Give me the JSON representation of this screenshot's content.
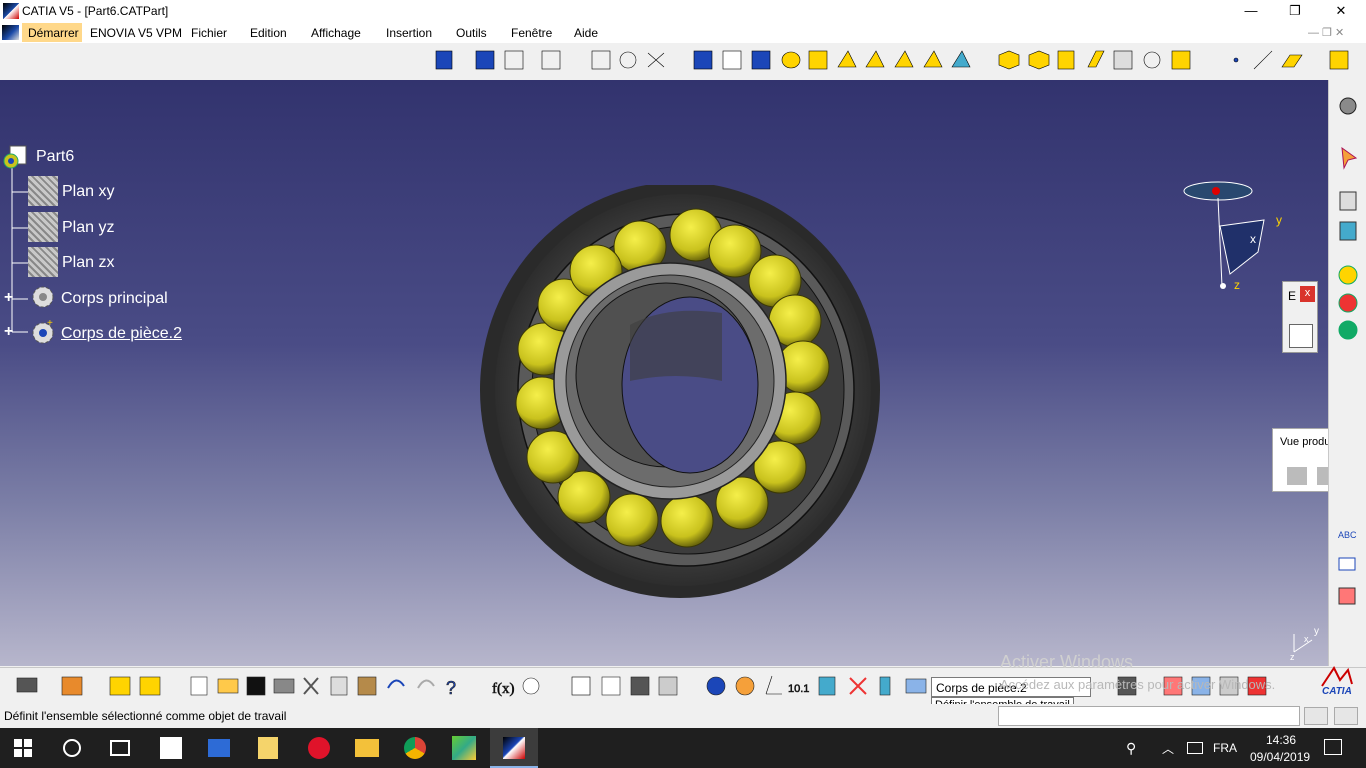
{
  "window": {
    "title": "CATIA V5 - [Part6.CATPart]",
    "minimize": "—",
    "maximize": "❐",
    "close": "✕"
  },
  "menu": {
    "items": [
      "Démarrer",
      "ENOVIA V5 VPM",
      "Fichier",
      "Edition",
      "Affichage",
      "Insertion",
      "Outils",
      "Fenêtre",
      "Aide"
    ]
  },
  "tree": {
    "root": "Part6",
    "items": [
      "Plan xy",
      "Plan yz",
      "Plan zx",
      "Corps principal",
      "Corps de pièce.2"
    ]
  },
  "compass": {
    "x": "x",
    "y": "y",
    "z": "z"
  },
  "floating_small": {
    "label": "E",
    "close": "x"
  },
  "floating_panel": {
    "title": "Vue produit résu"
  },
  "bottom": {
    "combo_value": "Corps de pièce.2",
    "tooltip": "Définir l'ensemble de travail",
    "watermark_line1": "Activer Windows",
    "watermark_line2": "Accédez aux paramètres pour activer Windows."
  },
  "status": {
    "message": "Définit l'ensemble sélectionné comme objet de travail"
  },
  "taskbar": {
    "lang": "FRA",
    "time": "14:36",
    "date": "09/04/2019"
  },
  "brand": {
    "catia": "CATIA"
  },
  "colors": {
    "viewport_top": "#32336e",
    "viewport_bottom": "#b7b6cc",
    "bearing_gray": "#4a4a4a",
    "ball_yellow": "#c9c21d",
    "tree_text": "#ffffff"
  }
}
